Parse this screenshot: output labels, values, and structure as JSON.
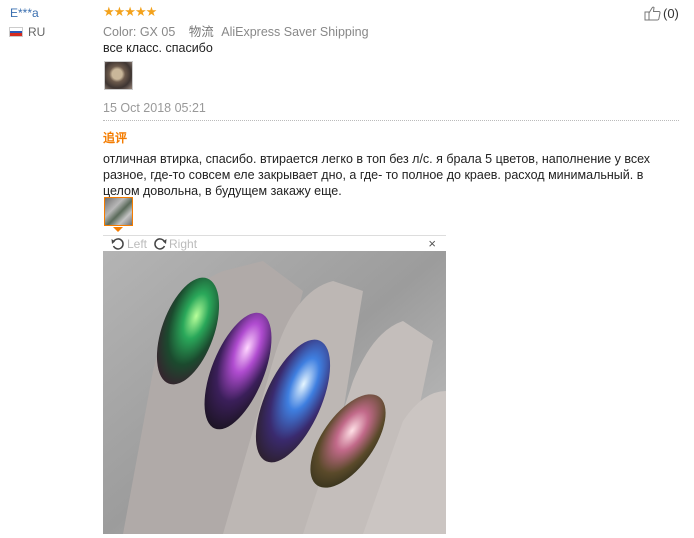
{
  "reviewer": {
    "name": "E***a",
    "country": "RU",
    "flag_colors": [
      "#ffffff",
      "#2c58b5",
      "#d52b1e"
    ]
  },
  "review": {
    "rating": 5,
    "stars_text": "★★★★★",
    "color_label": "Color:",
    "color_value": "GX 05",
    "shipping_label": "物流",
    "shipping_value": "AliExpress Saver Shipping",
    "text": "все класс. спасибо",
    "date": "15 Oct 2018 05:21",
    "helpful_count": "(0)"
  },
  "followup": {
    "label": "追评",
    "text": "отличная втирка, спасибо. втирается легко в топ без л/с. я брала 5 цветов, наполнение у всех разное, где-то совсем еле закрывает дно, а где- то полное до краев. расход минимальный. в целом довольна, в будущем закажу еще."
  },
  "viewer": {
    "rotate_left_label": "Left",
    "rotate_right_label": "Right",
    "close_label": "×"
  },
  "colors": {
    "accent": "#f47c00",
    "star": "#f3a21c",
    "link": "#3a6fb0"
  }
}
